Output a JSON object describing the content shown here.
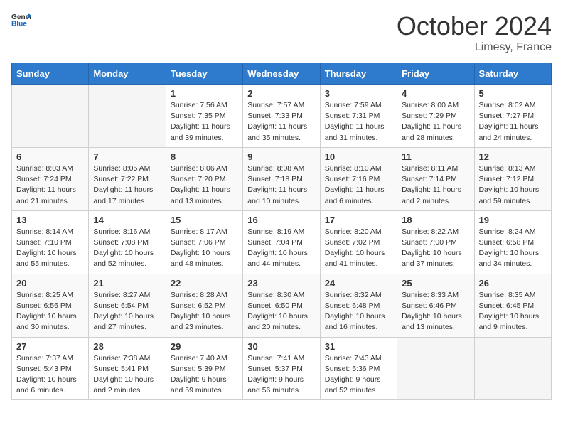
{
  "header": {
    "logo_general": "General",
    "logo_blue": "Blue",
    "month": "October 2024",
    "location": "Limesy, France"
  },
  "days_of_week": [
    "Sunday",
    "Monday",
    "Tuesday",
    "Wednesday",
    "Thursday",
    "Friday",
    "Saturday"
  ],
  "weeks": [
    [
      {
        "day": null
      },
      {
        "day": null
      },
      {
        "day": "1",
        "sunrise": "Sunrise: 7:56 AM",
        "sunset": "Sunset: 7:35 PM",
        "daylight": "Daylight: 11 hours and 39 minutes."
      },
      {
        "day": "2",
        "sunrise": "Sunrise: 7:57 AM",
        "sunset": "Sunset: 7:33 PM",
        "daylight": "Daylight: 11 hours and 35 minutes."
      },
      {
        "day": "3",
        "sunrise": "Sunrise: 7:59 AM",
        "sunset": "Sunset: 7:31 PM",
        "daylight": "Daylight: 11 hours and 31 minutes."
      },
      {
        "day": "4",
        "sunrise": "Sunrise: 8:00 AM",
        "sunset": "Sunset: 7:29 PM",
        "daylight": "Daylight: 11 hours and 28 minutes."
      },
      {
        "day": "5",
        "sunrise": "Sunrise: 8:02 AM",
        "sunset": "Sunset: 7:27 PM",
        "daylight": "Daylight: 11 hours and 24 minutes."
      }
    ],
    [
      {
        "day": "6",
        "sunrise": "Sunrise: 8:03 AM",
        "sunset": "Sunset: 7:24 PM",
        "daylight": "Daylight: 11 hours and 21 minutes."
      },
      {
        "day": "7",
        "sunrise": "Sunrise: 8:05 AM",
        "sunset": "Sunset: 7:22 PM",
        "daylight": "Daylight: 11 hours and 17 minutes."
      },
      {
        "day": "8",
        "sunrise": "Sunrise: 8:06 AM",
        "sunset": "Sunset: 7:20 PM",
        "daylight": "Daylight: 11 hours and 13 minutes."
      },
      {
        "day": "9",
        "sunrise": "Sunrise: 8:08 AM",
        "sunset": "Sunset: 7:18 PM",
        "daylight": "Daylight: 11 hours and 10 minutes."
      },
      {
        "day": "10",
        "sunrise": "Sunrise: 8:10 AM",
        "sunset": "Sunset: 7:16 PM",
        "daylight": "Daylight: 11 hours and 6 minutes."
      },
      {
        "day": "11",
        "sunrise": "Sunrise: 8:11 AM",
        "sunset": "Sunset: 7:14 PM",
        "daylight": "Daylight: 11 hours and 2 minutes."
      },
      {
        "day": "12",
        "sunrise": "Sunrise: 8:13 AM",
        "sunset": "Sunset: 7:12 PM",
        "daylight": "Daylight: 10 hours and 59 minutes."
      }
    ],
    [
      {
        "day": "13",
        "sunrise": "Sunrise: 8:14 AM",
        "sunset": "Sunset: 7:10 PM",
        "daylight": "Daylight: 10 hours and 55 minutes."
      },
      {
        "day": "14",
        "sunrise": "Sunrise: 8:16 AM",
        "sunset": "Sunset: 7:08 PM",
        "daylight": "Daylight: 10 hours and 52 minutes."
      },
      {
        "day": "15",
        "sunrise": "Sunrise: 8:17 AM",
        "sunset": "Sunset: 7:06 PM",
        "daylight": "Daylight: 10 hours and 48 minutes."
      },
      {
        "day": "16",
        "sunrise": "Sunrise: 8:19 AM",
        "sunset": "Sunset: 7:04 PM",
        "daylight": "Daylight: 10 hours and 44 minutes."
      },
      {
        "day": "17",
        "sunrise": "Sunrise: 8:20 AM",
        "sunset": "Sunset: 7:02 PM",
        "daylight": "Daylight: 10 hours and 41 minutes."
      },
      {
        "day": "18",
        "sunrise": "Sunrise: 8:22 AM",
        "sunset": "Sunset: 7:00 PM",
        "daylight": "Daylight: 10 hours and 37 minutes."
      },
      {
        "day": "19",
        "sunrise": "Sunrise: 8:24 AM",
        "sunset": "Sunset: 6:58 PM",
        "daylight": "Daylight: 10 hours and 34 minutes."
      }
    ],
    [
      {
        "day": "20",
        "sunrise": "Sunrise: 8:25 AM",
        "sunset": "Sunset: 6:56 PM",
        "daylight": "Daylight: 10 hours and 30 minutes."
      },
      {
        "day": "21",
        "sunrise": "Sunrise: 8:27 AM",
        "sunset": "Sunset: 6:54 PM",
        "daylight": "Daylight: 10 hours and 27 minutes."
      },
      {
        "day": "22",
        "sunrise": "Sunrise: 8:28 AM",
        "sunset": "Sunset: 6:52 PM",
        "daylight": "Daylight: 10 hours and 23 minutes."
      },
      {
        "day": "23",
        "sunrise": "Sunrise: 8:30 AM",
        "sunset": "Sunset: 6:50 PM",
        "daylight": "Daylight: 10 hours and 20 minutes."
      },
      {
        "day": "24",
        "sunrise": "Sunrise: 8:32 AM",
        "sunset": "Sunset: 6:48 PM",
        "daylight": "Daylight: 10 hours and 16 minutes."
      },
      {
        "day": "25",
        "sunrise": "Sunrise: 8:33 AM",
        "sunset": "Sunset: 6:46 PM",
        "daylight": "Daylight: 10 hours and 13 minutes."
      },
      {
        "day": "26",
        "sunrise": "Sunrise: 8:35 AM",
        "sunset": "Sunset: 6:45 PM",
        "daylight": "Daylight: 10 hours and 9 minutes."
      }
    ],
    [
      {
        "day": "27",
        "sunrise": "Sunrise: 7:37 AM",
        "sunset": "Sunset: 5:43 PM",
        "daylight": "Daylight: 10 hours and 6 minutes."
      },
      {
        "day": "28",
        "sunrise": "Sunrise: 7:38 AM",
        "sunset": "Sunset: 5:41 PM",
        "daylight": "Daylight: 10 hours and 2 minutes."
      },
      {
        "day": "29",
        "sunrise": "Sunrise: 7:40 AM",
        "sunset": "Sunset: 5:39 PM",
        "daylight": "Daylight: 9 hours and 59 minutes."
      },
      {
        "day": "30",
        "sunrise": "Sunrise: 7:41 AM",
        "sunset": "Sunset: 5:37 PM",
        "daylight": "Daylight: 9 hours and 56 minutes."
      },
      {
        "day": "31",
        "sunrise": "Sunrise: 7:43 AM",
        "sunset": "Sunset: 5:36 PM",
        "daylight": "Daylight: 9 hours and 52 minutes."
      },
      {
        "day": null
      },
      {
        "day": null
      }
    ]
  ]
}
